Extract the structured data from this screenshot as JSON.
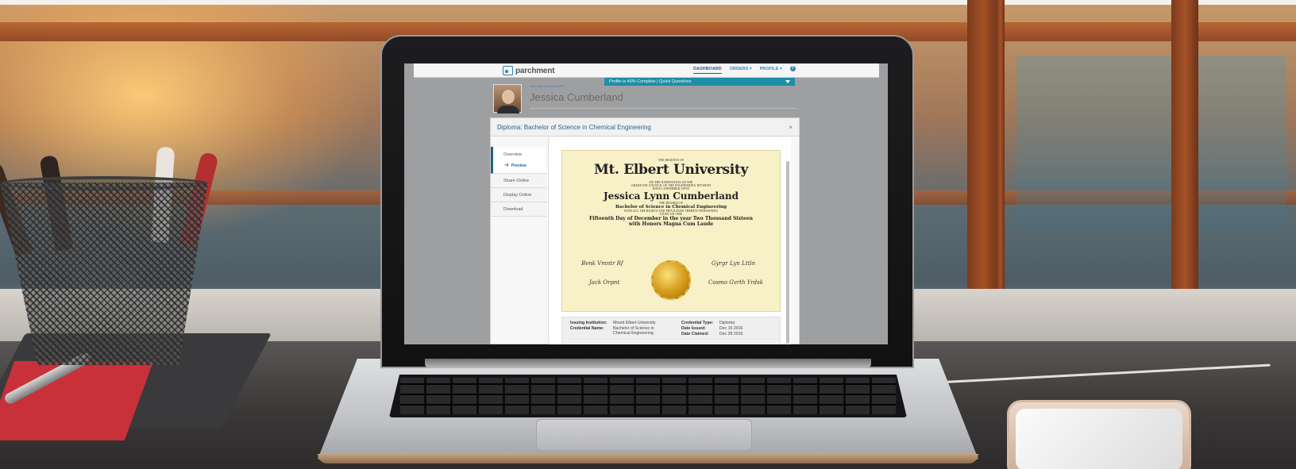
{
  "app": {
    "logo_text": "parchment",
    "nav": {
      "dashboard": "DASHBOARD",
      "orders": "ORDERS",
      "profile": "PROFILE",
      "help": "?"
    },
    "progress_banner": "Profile is 40% Complete | Quick Questions",
    "breadcrumb": "Edit Profile  |  Edit Profile Pic",
    "profile_name": "Jessica Cumberland"
  },
  "modal": {
    "title": "Diploma: Bachelor of Science in Chemical Engineering",
    "close": "×",
    "sidebar": {
      "overview": "Overview",
      "preview": "Preview",
      "share_online": "Share Online",
      "display_online": "Display Online",
      "download": "Download"
    }
  },
  "diploma": {
    "line1": "THE REGENTS OF",
    "university": "Mt. Elbert University",
    "line2": "ON THE NOMINATION OF THE",
    "line3": "GRADUATE COUNCIL OF THE ENGINEERING DIVISION",
    "line4": "HAVE CONFERRED UPON",
    "recipient": "Jessica Lynn Cumberland",
    "line5": "THE DEGREE OF",
    "degree": "Bachelor of Science in Chemical Engineering",
    "line6": "WITH ALL THE RIGHTS AND PRIVILEGES THERETO PERTAINING",
    "line7": "GIVEN ON THIS",
    "date_line": "Fifteenth Day of December in the year Two Thousand Sixteen",
    "honors": "with Honors Magna Cum Laude"
  },
  "details": {
    "issuing_institution_label": "Issuing Institution:",
    "issuing_institution": "Mount Elbert University",
    "credential_name_label": "Credential Name:",
    "credential_name": "Bachelor of Science in Chemical Engineering",
    "credential_type_label": "Credential Type:",
    "credential_type": "Diploma",
    "date_issued_label": "Date Issued:",
    "date_issued": "Dec 15 2016",
    "date_claimed_label": "Date Claimed:",
    "date_claimed": "Dec 28 2016"
  },
  "colors": {
    "brand_blue": "#1f5f8b",
    "banner_teal": "#1f8ea8",
    "diploma_paper": "#f8f0c6",
    "seal_gold": "#d49a1a"
  }
}
